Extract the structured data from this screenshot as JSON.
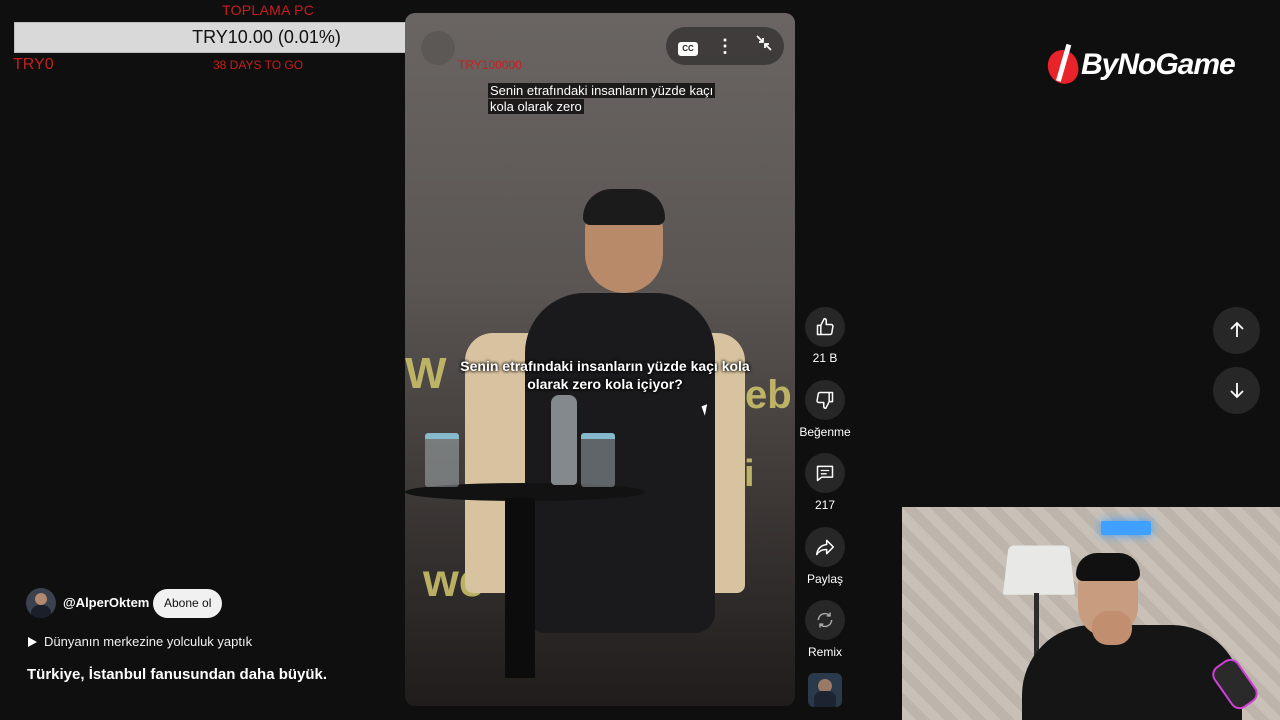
{
  "donation_goal": {
    "title": "TOPLAMA PC",
    "amount_text": "TRY10.00 (0.01%)",
    "progress_percent": 0.01,
    "current_text": "TRY0",
    "days_text": "38 DAYS TO GO",
    "target_text": "TRY100000",
    "colors": {
      "accent": "#c81e1e",
      "bar_bg": "#d9d9d9"
    }
  },
  "video": {
    "subtitle_top": "Senin etrafındaki insanların yüzde kaçı kola olarak zero",
    "subtitle_burned": "Senin etrafındaki insanların yüzde kaçı kola olarak zero kola içiyor?",
    "controls": {
      "cc_icon": "closed-captions-icon",
      "cc_text": "CC",
      "more_icon": "more-vertical-icon",
      "exit_fullscreen_icon": "exit-fullscreen-icon"
    }
  },
  "actions": {
    "like": {
      "icon": "thumbs-up-icon",
      "label": "21 B"
    },
    "dislike": {
      "icon": "thumbs-down-icon",
      "label": "Beğenme"
    },
    "comments": {
      "icon": "comment-icon",
      "label": "217"
    },
    "share": {
      "icon": "share-icon",
      "label": "Paylaş"
    },
    "remix": {
      "icon": "remix-icon",
      "label": "Remix"
    }
  },
  "channel": {
    "handle": "@AlperOktem",
    "subscribe_label": "Abone ol"
  },
  "playlist": {
    "label": "Dünyanın merkezine yolculuk yaptık"
  },
  "title": "Türkiye, İstanbul fanusundan daha büyük.",
  "navigation": {
    "previous_icon": "arrow-up-icon",
    "next_icon": "arrow-down-icon"
  },
  "sponsor": {
    "name": "ByNoGame",
    "brand_color": "#e8232a"
  }
}
